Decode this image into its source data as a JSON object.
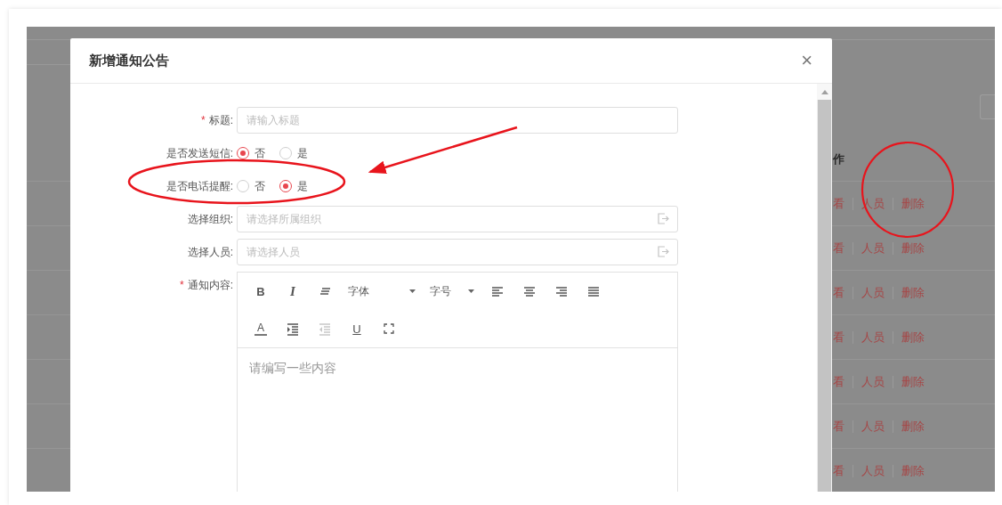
{
  "background_table": {
    "columns": [
      "作"
    ],
    "rows": [
      {
        "actions": [
          "看",
          "人员",
          "删除"
        ]
      },
      {
        "actions": [
          "看",
          "人员",
          "删除"
        ]
      },
      {
        "actions": [
          "看",
          "人员",
          "删除"
        ]
      },
      {
        "actions": [
          "看",
          "人员",
          "删除"
        ]
      },
      {
        "actions": [
          "看",
          "人员",
          "删除"
        ]
      },
      {
        "actions": [
          "看",
          "人员",
          "删除"
        ]
      },
      {
        "actions": [
          "看",
          "人员",
          "删除"
        ]
      }
    ]
  },
  "dialog": {
    "title": "新增通知公告",
    "close": "×",
    "fields": [
      {
        "kind": "input",
        "label": "标题:",
        "required_mark": "*",
        "placeholder": "请输入标题"
      },
      {
        "kind": "radio",
        "label": "是否发送短信:",
        "options": [
          {
            "label": "否",
            "selected": true
          },
          {
            "label": "是",
            "selected": false
          }
        ]
      },
      {
        "kind": "radio",
        "label": "是否电话提醒:",
        "options": [
          {
            "label": "否",
            "selected": false
          },
          {
            "label": "是",
            "selected": true
          }
        ]
      },
      {
        "kind": "picker",
        "label": "选择组织:",
        "placeholder": "请选择所属组织"
      },
      {
        "kind": "picker",
        "label": "选择人员:",
        "placeholder": "请选择人员"
      },
      {
        "kind": "editor",
        "label": "通知内容:",
        "required_mark": "*",
        "placeholder": "请编写一些内容",
        "toolbar": [
          [
            {
              "kind": "bold",
              "label": "B"
            },
            {
              "kind": "italic",
              "label": "I"
            },
            {
              "kind": "lines"
            },
            {
              "kind": "select",
              "label": "字体"
            },
            {
              "kind": "select",
              "label": "字号"
            },
            {
              "kind": "align-left"
            },
            {
              "kind": "align-center"
            },
            {
              "kind": "align-right"
            },
            {
              "kind": "justify"
            }
          ],
          [
            {
              "kind": "font-color",
              "label": "A"
            },
            {
              "kind": "indent",
              "disabled": false
            },
            {
              "kind": "outdent",
              "disabled": true
            },
            {
              "kind": "underline",
              "label": "U"
            },
            {
              "kind": "fullscreen"
            }
          ]
        ]
      }
    ]
  }
}
